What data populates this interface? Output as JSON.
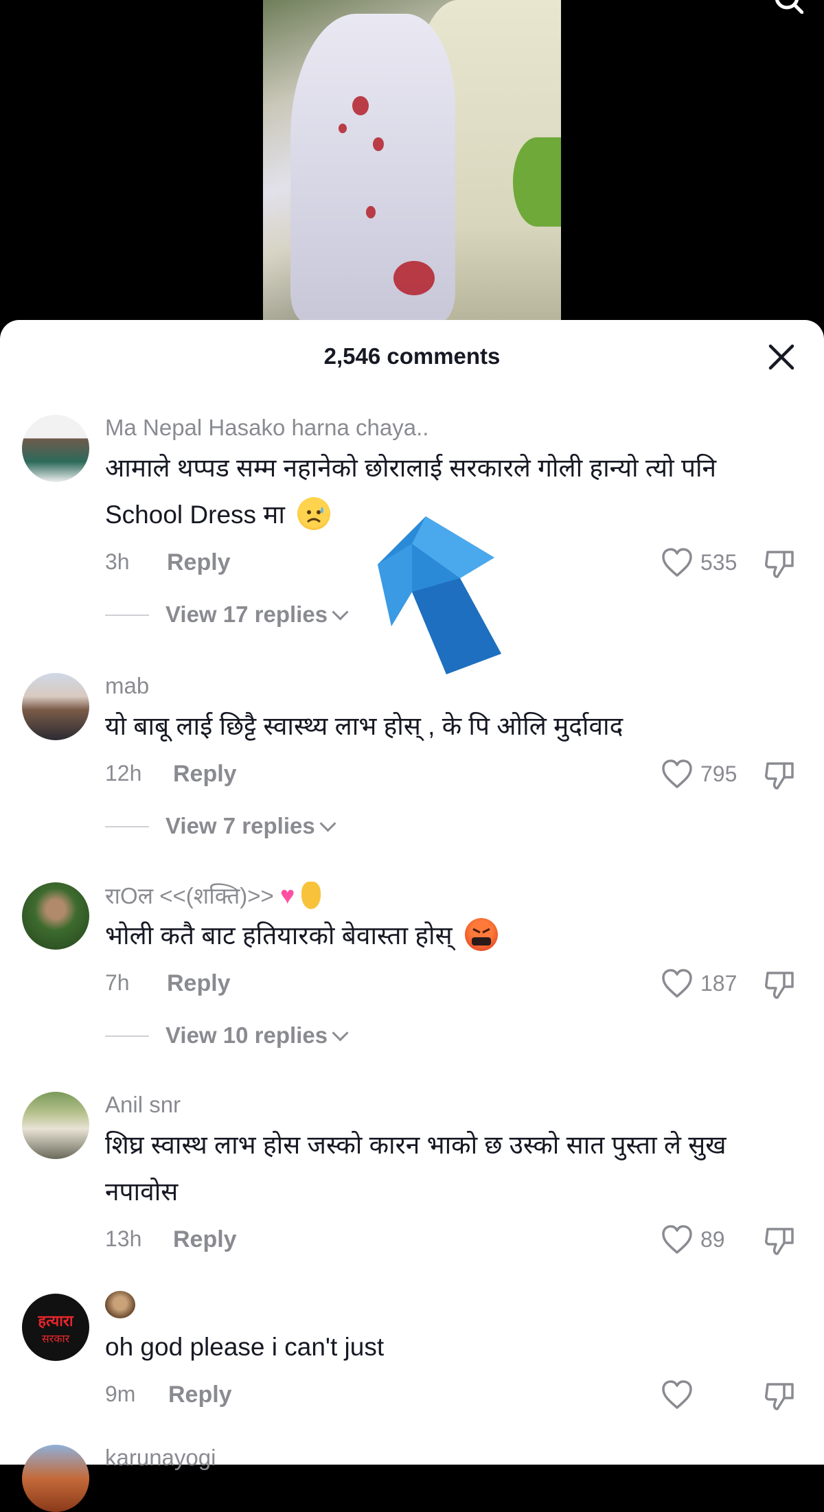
{
  "header": {
    "comment_count": "2,546 comments"
  },
  "comments": [
    {
      "username": "Ma Nepal Hasako harna chaya..",
      "text_line1": "आमाले थप्पड सम्म नहानेको छोरालाई सरकारले गोली हान्यो त्यो पनि",
      "text_line2": "School Dress मा",
      "time": "3h",
      "reply": "Reply",
      "likes": "535",
      "view_replies": "View 17 replies"
    },
    {
      "username": "mab",
      "text_line1": "यो बाबू लाई छिट्टै स्वास्थ्य लाभ होस् , के पि ओलि मुर्दावाद",
      "time": "12h",
      "reply": "Reply",
      "likes": "795",
      "view_replies": "View 7 replies"
    },
    {
      "username": "राOल <<(शक्ति)>>",
      "text_line1": "भोली कतै बाट हतियारको बेवास्ता होस्",
      "time": "7h",
      "reply": "Reply",
      "likes": "187",
      "view_replies": "View 10 replies"
    },
    {
      "username": "Anil snr",
      "text_line1": "शिघ्र स्वास्थ लाभ होस जस्को कारन भाको छ उस्को सात पुस्ता ले सुख",
      "text_line2": "नपावोस",
      "time": "13h",
      "reply": "Reply",
      "likes": "89"
    },
    {
      "avatar_text_1": "हत्यारा",
      "avatar_text_2": "सरकार",
      "text_line1": "oh god please i can't just",
      "time": "9m",
      "reply": "Reply"
    },
    {
      "username": "karunayogi"
    }
  ],
  "icons": {
    "search": "search-icon",
    "close": "close-icon",
    "like": "heart-icon",
    "dislike": "thumbs-down-icon",
    "arrow": "arrow-up-icon"
  }
}
